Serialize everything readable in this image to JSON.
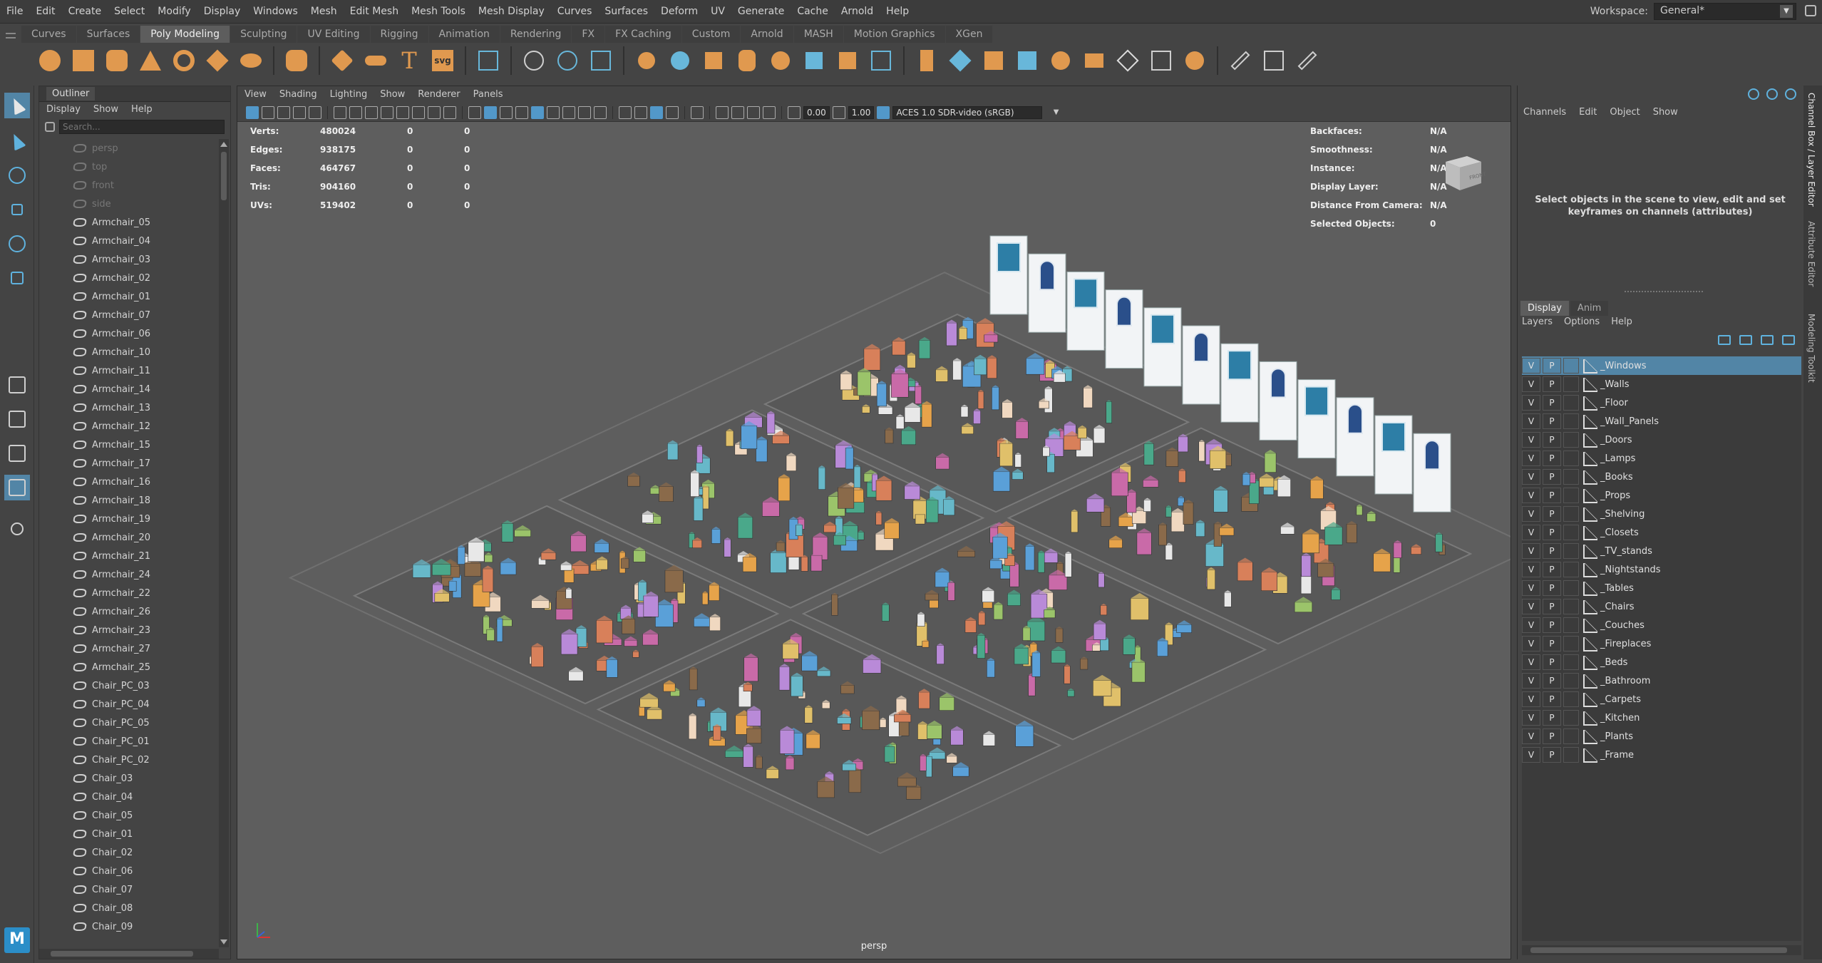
{
  "menubar": [
    "File",
    "Edit",
    "Create",
    "Select",
    "Modify",
    "Display",
    "Windows",
    "Mesh",
    "Edit Mesh",
    "Mesh Tools",
    "Mesh Display",
    "Curves",
    "Surfaces",
    "Deform",
    "UV",
    "Generate",
    "Cache",
    "Arnold",
    "Help"
  ],
  "workspace": {
    "label": "Workspace:",
    "value": "General*"
  },
  "shelf_tabs": [
    "Curves",
    "Surfaces",
    "Poly Modeling",
    "Sculpting",
    "UV Editing",
    "Rigging",
    "Animation",
    "Rendering",
    "FX",
    "FX Caching",
    "Custom",
    "Arnold",
    "MASH",
    "Motion Graphics",
    "XGen"
  ],
  "shelf_active_tab": "Poly Modeling",
  "shelf_icons": {
    "text_tool": "T",
    "svg_tool": "svg"
  },
  "outliner": {
    "title": "Outliner",
    "menu": [
      "Display",
      "Show",
      "Help"
    ],
    "search_placeholder": "Search...",
    "cameras": [
      "persp",
      "top",
      "front",
      "side"
    ],
    "items": [
      "Armchair_05",
      "Armchair_04",
      "Armchair_03",
      "Armchair_02",
      "Armchair_01",
      "Armchair_07",
      "Armchair_06",
      "Armchair_10",
      "Armchair_11",
      "Armchair_14",
      "Armchair_13",
      "Armchair_12",
      "Armchair_15",
      "Armchair_17",
      "Armchair_16",
      "Armchair_18",
      "Armchair_19",
      "Armchair_20",
      "Armchair_21",
      "Armchair_24",
      "Armchair_22",
      "Armchair_26",
      "Armchair_23",
      "Armchair_27",
      "Armchair_25",
      "Chair_PC_03",
      "Chair_PC_04",
      "Chair_PC_05",
      "Chair_PC_01",
      "Chair_PC_02",
      "Chair_03",
      "Chair_04",
      "Chair_05",
      "Chair_01",
      "Chair_02",
      "Chair_06",
      "Chair_07",
      "Chair_08",
      "Chair_09"
    ]
  },
  "viewport": {
    "menu": [
      "View",
      "Shading",
      "Lighting",
      "Show",
      "Renderer",
      "Panels"
    ],
    "exposure": "0.00",
    "gamma": "1.00",
    "colorspace": "ACES 1.0 SDR-video (sRGB)",
    "camera_label": "persp",
    "hud_left": [
      {
        "label": "Verts:",
        "v1": "480024",
        "v2": "0",
        "v3": "0"
      },
      {
        "label": "Edges:",
        "v1": "938175",
        "v2": "0",
        "v3": "0"
      },
      {
        "label": "Faces:",
        "v1": "464767",
        "v2": "0",
        "v3": "0"
      },
      {
        "label": "Tris:",
        "v1": "904160",
        "v2": "0",
        "v3": "0"
      },
      {
        "label": "UVs:",
        "v1": "519402",
        "v2": "0",
        "v3": "0"
      }
    ],
    "hud_right": [
      {
        "label": "Backfaces:",
        "value": "N/A"
      },
      {
        "label": "Smoothness:",
        "value": "N/A"
      },
      {
        "label": "Instance:",
        "value": "N/A"
      },
      {
        "label": "Display Layer:",
        "value": "N/A"
      },
      {
        "label": "Distance From Camera:",
        "value": "N/A"
      },
      {
        "label": "Selected Objects:",
        "value": "0"
      }
    ],
    "viewcube_label": "FRONT"
  },
  "channel_box": {
    "menu": [
      "Channels",
      "Edit",
      "Object",
      "Show"
    ],
    "message": "Select objects in the scene to view, edit and set keyframes on channels (attributes)"
  },
  "layer_editor": {
    "tabs": [
      "Display",
      "Anim"
    ],
    "active_tab": "Display",
    "menu": [
      "Layers",
      "Options",
      "Help"
    ],
    "layers": [
      "_Windows",
      "_Walls",
      "_Floor",
      "_Wall_Panels",
      "_Doors",
      "_Lamps",
      "_Books",
      "_Props",
      "_Shelving",
      "_Closets",
      "_TV_stands",
      "_Nightstands",
      "_Tables",
      "_Chairs",
      "_Couches",
      "_Fireplaces",
      "_Beds",
      "_Bathroom",
      "_Carpets",
      "_Kitchen",
      "_Plants",
      "_Frame"
    ],
    "selected": "_Windows",
    "v_label": "V",
    "p_label": "P"
  },
  "side_tabs": [
    "Channel Box / Layer Editor",
    "Attribute Editor",
    "Modeling Toolkit"
  ],
  "logo_letter": "M",
  "colors": {
    "accent": "#5285a6",
    "shelf_orange": "#e0994f",
    "viewport_bg": "#5e5e5e"
  }
}
